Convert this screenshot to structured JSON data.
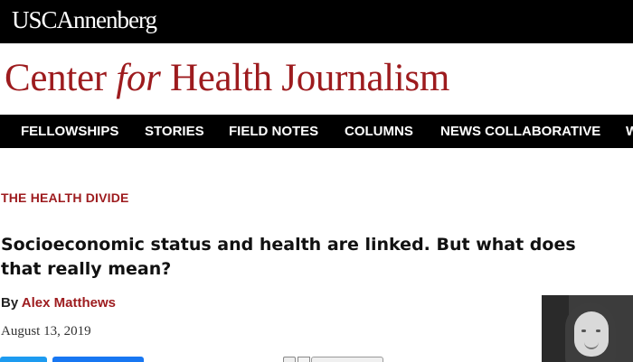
{
  "header": {
    "usc_logo": "USCAnnenberg",
    "site_title_before": "Center ",
    "site_title_for": "for",
    "site_title_after": " Health Journalism"
  },
  "nav": {
    "items": [
      {
        "label": "FELLOWSHIPS"
      },
      {
        "label": "STORIES"
      },
      {
        "label": "FIELD NOTES"
      },
      {
        "label": "COLUMNS"
      },
      {
        "label": "NEWS COLLABORATIVE"
      },
      {
        "label": "W"
      }
    ]
  },
  "article": {
    "section": "THE HEALTH DIVIDE",
    "headline": "Socioeconomic status and health are linked. But what does that really mean?",
    "byline_prefix": "By ",
    "author": "Alex Matthews",
    "date": "August 13, 2019"
  },
  "colors": {
    "brand": "#9d1b1e",
    "bars": "#000000"
  },
  "icons": {
    "print": "print-icon",
    "email": "email-icon"
  }
}
